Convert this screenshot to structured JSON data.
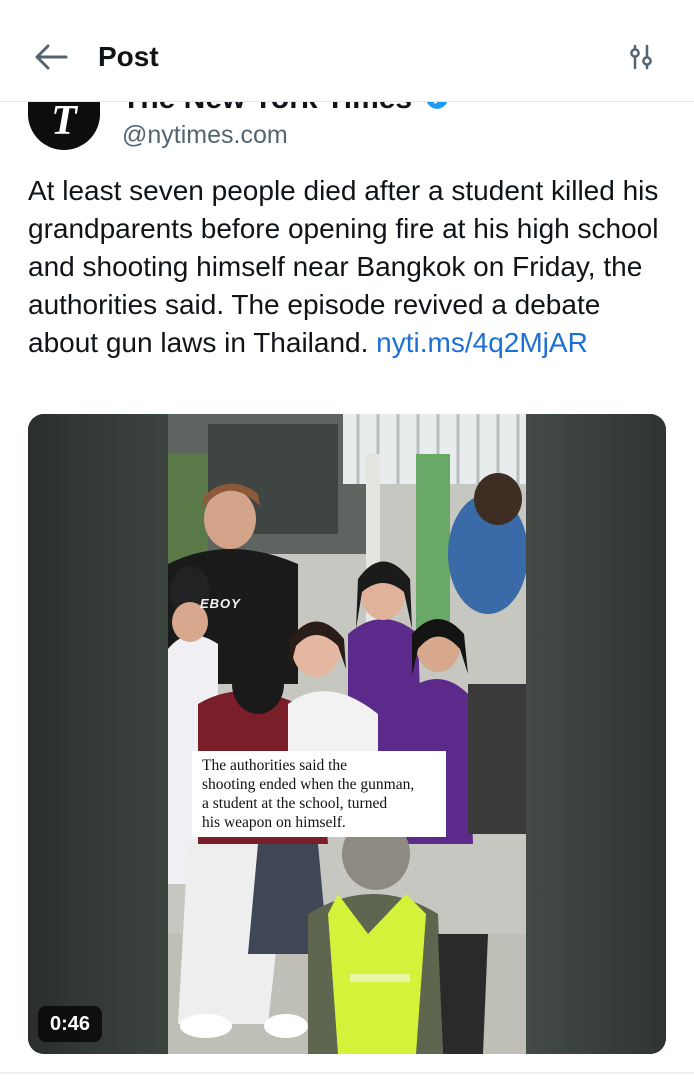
{
  "header": {
    "title": "Post",
    "back_icon": "arrow-left-icon",
    "filter_icon": "sliders-icon"
  },
  "author": {
    "display_name": "The New York Times",
    "handle": "@nytimes.com",
    "avatar_glyph": "T",
    "verified_icon": "verified-badge-icon",
    "verified_color": "#1d9bf0"
  },
  "post": {
    "text": "At least seven people died after a student killed his grandparents before opening fire at his high school and shooting himself near Bangkok on Friday, the authorities said. The episode revived a debate about gun laws in Thailand.",
    "link": "nyti.ms/4q2MjAR",
    "link_color": "#1d6fd6"
  },
  "media": {
    "shirt_text": "EBOY",
    "caption_lines": [
      "The authorities said the",
      "shooting ended when the gunman,",
      "a student at the school, turned",
      "his weapon on himself."
    ],
    "duration": "0:46"
  }
}
